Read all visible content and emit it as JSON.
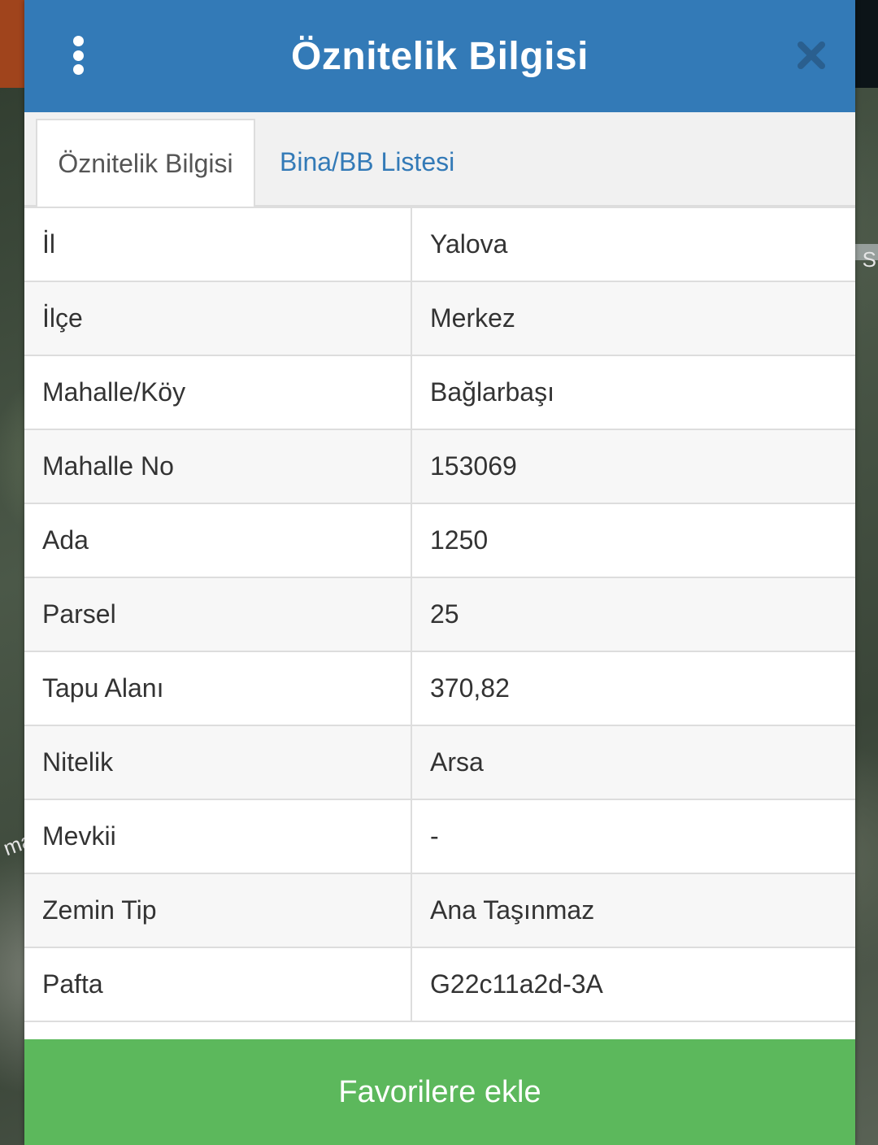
{
  "header": {
    "title": "Öznitelik Bilgisi"
  },
  "tabs": [
    {
      "label": "Öznitelik Bilgisi",
      "active": true
    },
    {
      "label": "Bina/BB Listesi",
      "active": false
    }
  ],
  "attributes": [
    {
      "key": "İl",
      "value": "Yalova"
    },
    {
      "key": "İlçe",
      "value": "Merkez"
    },
    {
      "key": "Mahalle/Köy",
      "value": "Bağlarbaşı"
    },
    {
      "key": "Mahalle No",
      "value": "153069"
    },
    {
      "key": "Ada",
      "value": "1250"
    },
    {
      "key": "Parsel",
      "value": "25"
    },
    {
      "key": "Tapu Alanı",
      "value": "370,82"
    },
    {
      "key": "Nitelik",
      "value": "Arsa"
    },
    {
      "key": "Mevkii",
      "value": "-"
    },
    {
      "key": "Zemin Tip",
      "value": "Ana Taşınmaz"
    },
    {
      "key": "Pafta",
      "value": "G22c11a2d-3A"
    }
  ],
  "footer": {
    "favorite_label": "Favorilere ekle"
  },
  "map": {
    "label_left": "ma",
    "label_right": "S"
  },
  "colors": {
    "header": "#337ab7",
    "tab_link": "#337ab7",
    "button": "#5cb85c"
  },
  "icons": {
    "menu": "vertical-dots-icon",
    "close": "close-x-icon"
  }
}
